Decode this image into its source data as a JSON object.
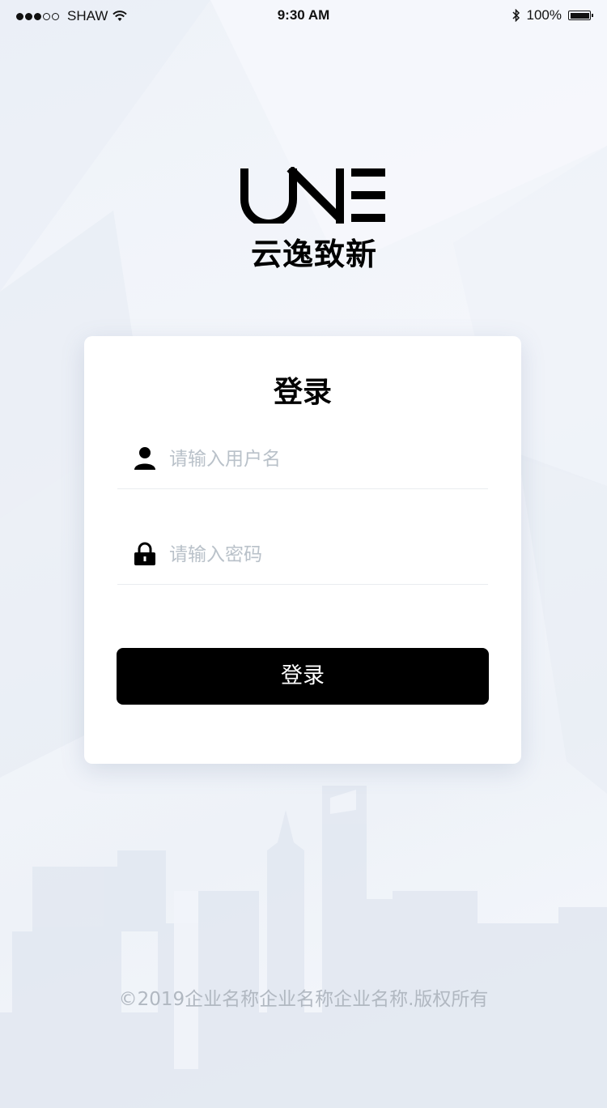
{
  "status_bar": {
    "carrier": "SHAW",
    "time": "9:30 AM",
    "battery": "100%"
  },
  "logo": {
    "wordmark": "UNE",
    "tagline": "云逸致新"
  },
  "login_card": {
    "title": "登录",
    "username_placeholder": "请输入用户名",
    "username_value": "",
    "password_placeholder": "请输入密码",
    "password_value": "",
    "submit_label": "登录"
  },
  "footer": {
    "copyright": "©2019企业名称企业名称企业名称.版权所有"
  }
}
